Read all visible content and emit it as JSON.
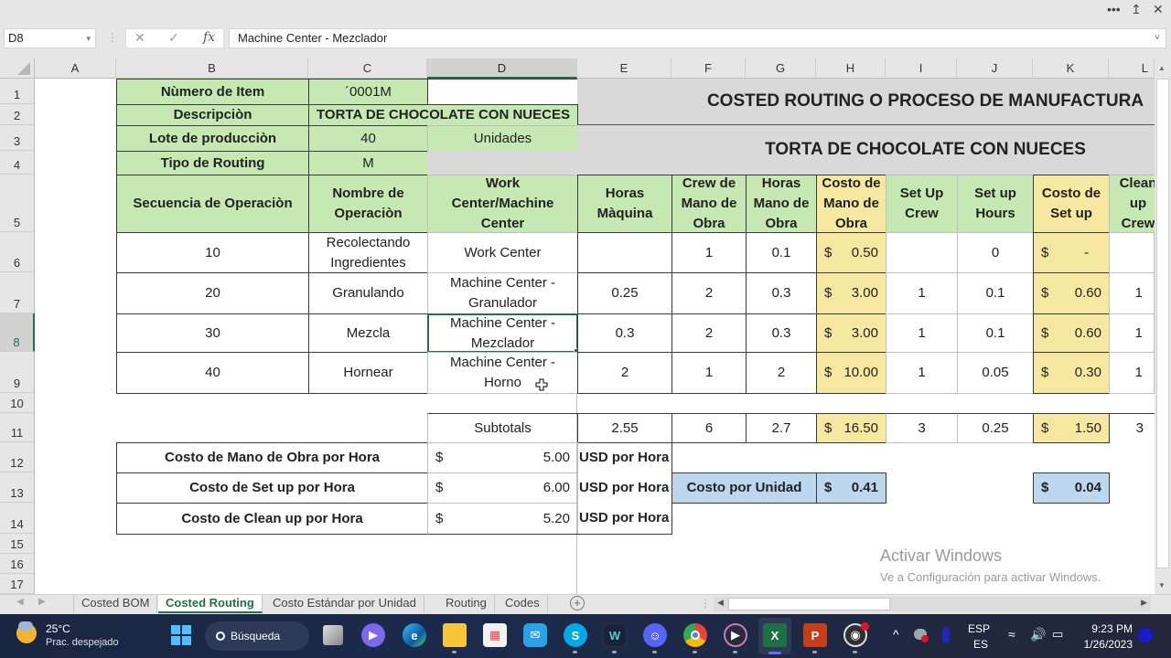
{
  "window": {
    "controls": {
      "more": "•••",
      "restore": "↥",
      "close": "✕"
    }
  },
  "formula_bar": {
    "name_box": "D8",
    "name_box_dropdown": "▾",
    "cancel_icon": "✕",
    "enter_icon": "✓",
    "fx_label": "fx",
    "value": "Machine Center - Mezclador",
    "expand_icon": "˅"
  },
  "grid": {
    "columns": [
      "A",
      "B",
      "C",
      "D",
      "E",
      "F",
      "G",
      "H",
      "I",
      "J",
      "K",
      "L"
    ],
    "selected_column": "D",
    "rows": [
      "1",
      "2",
      "3",
      "4",
      "5",
      "6",
      "7",
      "8",
      "9",
      "10",
      "11",
      "12",
      "13",
      "14",
      "15",
      "16",
      "17"
    ],
    "selected_row": "8",
    "selected_cell": "D8"
  },
  "header_info": {
    "item_number_label": "Nùmero de Item",
    "item_number_value": "´0001M",
    "description_label": "Descripciòn",
    "description_value": "TORTA DE CHOCOLATE CON NUECES",
    "lot_label": "Lote de producciòn",
    "lot_value": "40",
    "lot_unit": "Unidades",
    "routing_type_label": "Tipo de Routing",
    "routing_type_value": "M",
    "title": "COSTED ROUTING O PROCESO DE MANUFACTURA",
    "subtitle": "TORTA DE CHOCOLATE CON NUECES"
  },
  "table": {
    "headers": [
      "Secuencia de Operaciòn",
      "Nombre de Operaciòn",
      "Work Center/Machine Center",
      "Horas Màquina",
      "Crew de Mano de Obra",
      "Horas Mano de Obra",
      "Costo de Mano de Obra",
      "Set Up Crew",
      "Set up Hours",
      "Costo de Set up",
      "Clean up Crew"
    ],
    "rows": [
      {
        "seq": "10",
        "name": "Recolectando Ingredientes",
        "center": "Work Center",
        "machine_hours": "",
        "crew": "1",
        "labor_hours": "0.1",
        "labor_cost_sym": "$",
        "labor_cost": "0.50",
        "setup_crew": "",
        "setup_hours": "0",
        "setup_cost_sym": "$",
        "setup_cost": "-",
        "clean_crew": ""
      },
      {
        "seq": "20",
        "name": "Granulando",
        "center": "Machine Center - Granulador",
        "machine_hours": "0.25",
        "crew": "2",
        "labor_hours": "0.3",
        "labor_cost_sym": "$",
        "labor_cost": "3.00",
        "setup_crew": "1",
        "setup_hours": "0.1",
        "setup_cost_sym": "$",
        "setup_cost": "0.60",
        "clean_crew": "1"
      },
      {
        "seq": "30",
        "name": "Mezcla",
        "center": "Machine Center - Mezclador",
        "machine_hours": "0.3",
        "crew": "2",
        "labor_hours": "0.3",
        "labor_cost_sym": "$",
        "labor_cost": "3.00",
        "setup_crew": "1",
        "setup_hours": "0.1",
        "setup_cost_sym": "$",
        "setup_cost": "0.60",
        "clean_crew": "1"
      },
      {
        "seq": "40",
        "name": "Hornear",
        "center": "Machine Center - Horno",
        "machine_hours": "2",
        "crew": "1",
        "labor_hours": "2",
        "labor_cost_sym": "$",
        "labor_cost": "10.00",
        "setup_crew": "1",
        "setup_hours": "0.05",
        "setup_cost_sym": "$",
        "setup_cost": "0.30",
        "clean_crew": "1"
      }
    ],
    "subtotals": {
      "label": "Subtotals",
      "machine_hours": "2.55",
      "crew": "6",
      "labor_hours": "2.7",
      "labor_cost_sym": "$",
      "labor_cost": "16.50",
      "setup_crew": "3",
      "setup_hours": "0.25",
      "setup_cost_sym": "$",
      "setup_cost": "1.50",
      "clean_crew": "3"
    }
  },
  "rates": [
    {
      "label": "Costo de Mano de Obra por Hora",
      "sym": "$",
      "value": "5.00",
      "unit": "USD por Hora"
    },
    {
      "label": "Costo de Set up por Hora",
      "sym": "$",
      "value": "6.00",
      "unit": "USD por Hora"
    },
    {
      "label": "Costo de Clean up por Hora",
      "sym": "$",
      "value": "5.20",
      "unit": "USD por Hora"
    }
  ],
  "unit_cost": {
    "label": "Costo por Unidad",
    "labor_sym": "$",
    "labor_value": "0.41",
    "setup_sym": "$",
    "setup_value": "0.04"
  },
  "sheet_tabs": [
    {
      "label": "Costed BOM",
      "active": false
    },
    {
      "label": "Costed Routing",
      "active": true
    },
    {
      "label": "Costo Estándar por Unidad",
      "active": false
    },
    {
      "label": "Routing",
      "active": false
    },
    {
      "label": "Codes",
      "active": false
    }
  ],
  "add_sheet_icon": "+",
  "watermark": {
    "title": "Activar Windows",
    "subtitle": "Ve a Configuración para activar Windows."
  },
  "taskbar": {
    "weather_temp": "25°C",
    "weather_desc": "Prac. despejado",
    "search_label": "Búsqueda",
    "search_icon": "⚲",
    "language_top": "ESP",
    "language_bottom": "ES",
    "time": "9:23 PM",
    "date": "1/26/2023",
    "tray_chevron": "^",
    "apps": [
      {
        "name": "task-view",
        "glyph": ""
      },
      {
        "name": "teams-meet",
        "glyph": "▶"
      },
      {
        "name": "edge",
        "glyph": "e"
      },
      {
        "name": "file-explorer",
        "glyph": ""
      },
      {
        "name": "microsoft-store",
        "glyph": "▦"
      },
      {
        "name": "mail",
        "glyph": "✉"
      },
      {
        "name": "skype",
        "glyph": "S"
      },
      {
        "name": "webex",
        "glyph": "W"
      },
      {
        "name": "discord",
        "glyph": "☺"
      },
      {
        "name": "chrome",
        "glyph": ""
      },
      {
        "name": "media-player",
        "glyph": "▶"
      },
      {
        "name": "excel",
        "glyph": "X"
      },
      {
        "name": "powerpoint",
        "glyph": "P"
      },
      {
        "name": "obs",
        "glyph": "◉"
      }
    ]
  }
}
